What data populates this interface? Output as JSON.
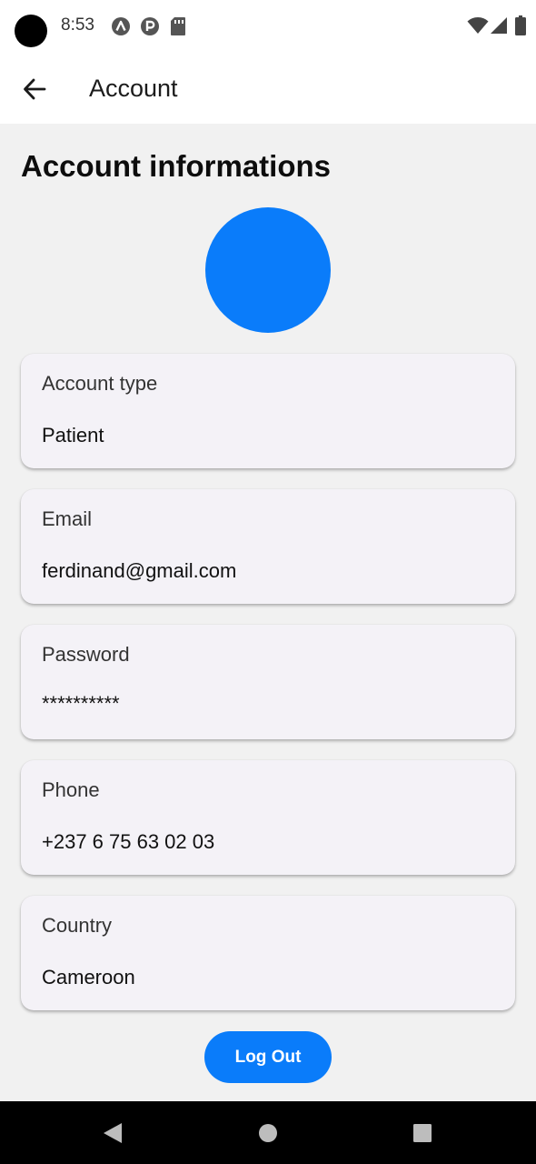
{
  "status_bar": {
    "time": "8:53",
    "icons": [
      "camera-cutout",
      "a-app-icon",
      "p-app-icon",
      "sd-card-icon",
      "wifi-icon",
      "signal-icon",
      "battery-icon"
    ]
  },
  "app_bar": {
    "back_icon": "arrow-left-icon",
    "title": "Account"
  },
  "main": {
    "section_title": "Account informations",
    "fields": [
      {
        "label": "Account type",
        "value": "Patient"
      },
      {
        "label": "Email",
        "value": "ferdinand@gmail.com"
      },
      {
        "label": "Password",
        "value": "**********"
      },
      {
        "label": "Phone",
        "value": "+237 6 75 63 02 03"
      },
      {
        "label": "Country",
        "value": "Cameroon"
      }
    ],
    "logout_label": "Log Out"
  },
  "colors": {
    "accent": "#0a7cfa",
    "card_background": "#f4f2f7",
    "page_background": "#f1f1f1"
  },
  "nav_bar": {
    "icons": [
      "nav-back-icon",
      "nav-home-icon",
      "nav-recents-icon"
    ]
  }
}
